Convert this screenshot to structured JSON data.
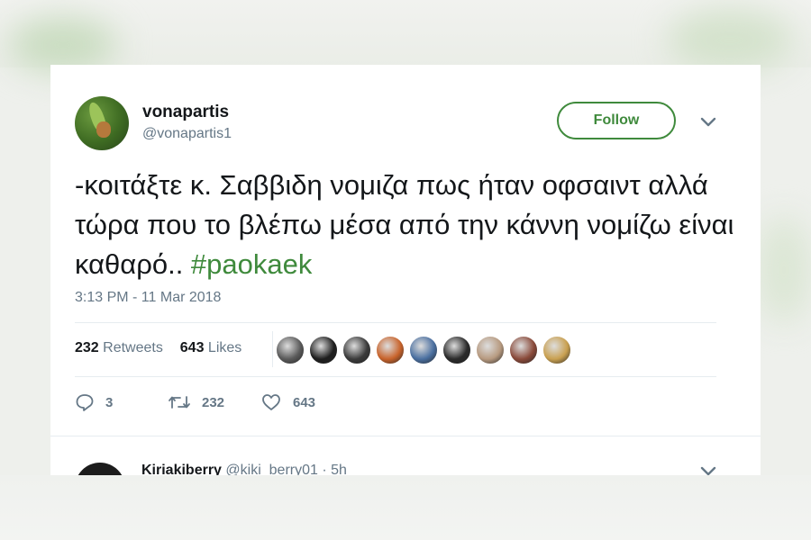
{
  "tweet": {
    "display_name": "vonapartis",
    "handle": "@vonapartis1",
    "follow_label": "Follow",
    "text_plain": "-κοιτάξτε κ. Σαββιδη νομιζα πως ήταν οφσαιντ αλλά τώρα που το βλέπω μέσα από την κάννη νομίζω είναι καθαρό.. ",
    "hashtag": "#paokaek",
    "timestamp": "3:13 PM - 11 Mar 2018",
    "stats": {
      "retweets_count": "232",
      "retweets_label": "Retweets",
      "likes_count": "643",
      "likes_label": "Likes"
    },
    "actions": {
      "reply_count": "3",
      "retweet_count": "232",
      "like_count": "643"
    },
    "accent_color": "#3f8a3c"
  },
  "liker_avatars": [
    "#5a5a5a",
    "#1e1e1e",
    "#3a3a3a",
    "#c8632b",
    "#4a6fa0",
    "#2a2a2a",
    "#b79a80",
    "#8a4a3a",
    "#c9a050"
  ],
  "reply": {
    "display_name": "Kiriakiberry",
    "handle_time": "@kiki_berry01 · 5h"
  },
  "icons": [
    "chevron-down-icon",
    "reply-icon",
    "retweet-icon",
    "heart-icon"
  ]
}
